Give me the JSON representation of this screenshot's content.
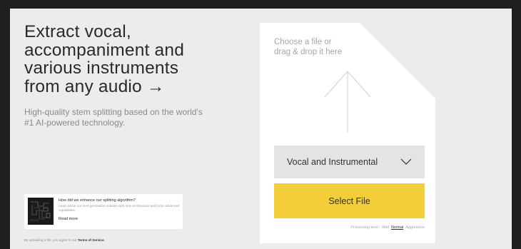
{
  "hero": {
    "headline_lines": [
      "Extract vocal,",
      "accompaniment and",
      "various instruments",
      "from any audio →"
    ],
    "subtitle": "High-quality stem splitting based on the world's #1 AI-powered technology."
  },
  "promo": {
    "title": "How did we enhance our splitting algorithm?",
    "description": "Learn about our next-generation solution with new architecture and more advanced capabilities.",
    "link": "Read more",
    "thumb_icon": "article-thumbnail"
  },
  "legal": {
    "prefix": "By uploading a file, you agree to our",
    "link": "Terms of Service."
  },
  "upload": {
    "prompt_lines": [
      "Choose a file or",
      "drag & drop it here"
    ],
    "upload_icon": "arrow-up-icon",
    "separation_type": "Vocal and Instrumental",
    "dropdown_icon": "chevron-down-icon",
    "select_button": "Select File",
    "button_color": "#f4cd3b",
    "processing_label": "Processing level:",
    "levels": [
      "Mild",
      "Normal",
      "Aggressive"
    ],
    "active_level": "Normal"
  }
}
